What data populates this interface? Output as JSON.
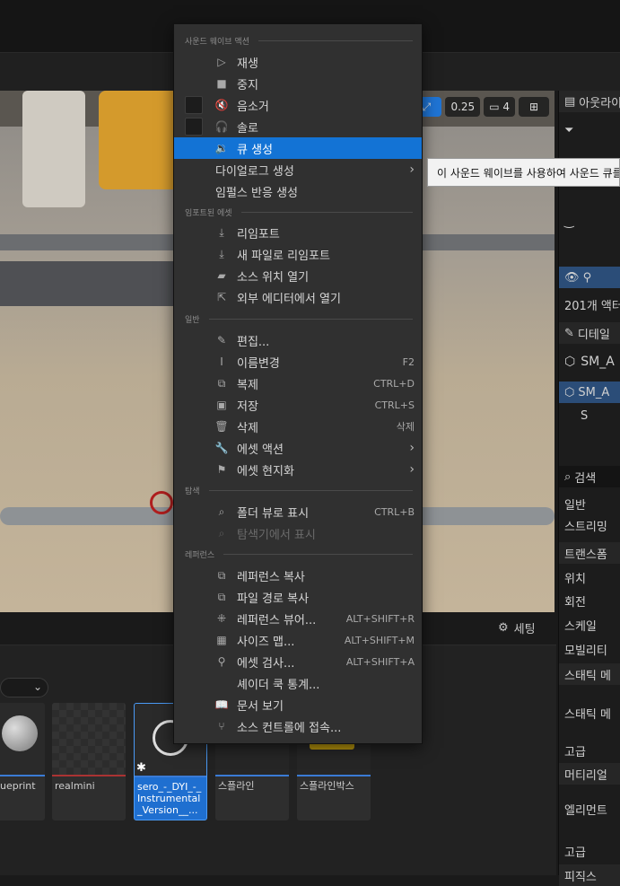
{
  "viewport": {
    "toolbar": {
      "speed": "0.25",
      "camera_speed": "4"
    }
  },
  "right_panel": {
    "outliner_title": "아웃라이",
    "actor_count": "201개 액터",
    "details_title": "디테일",
    "asset_name_1": "SM_A",
    "asset_name_2": "SM_A",
    "asset_sub": "S",
    "search_placeholder": "검색",
    "filter_general": "일반",
    "filter_streaming": "스트리밍",
    "section_transform": "트랜스폼",
    "transform_location": "위치",
    "transform_rotation": "회전",
    "transform_scale": "스케일",
    "mobility": "모빌리티",
    "section_static": "스태틱 메",
    "static_label": "스태틱 메",
    "advanced_1": "고급",
    "section_material": "머티리얼",
    "element_label": "엘리먼트",
    "advanced_2": "고급",
    "section_physics": "피직스"
  },
  "content_browser": {
    "settings_label": "세팅",
    "tiles": [
      {
        "label": "ueprint"
      },
      {
        "label": "realmini"
      },
      {
        "label": "sero_-_DYI_-_Instrumental_Version__..."
      },
      {
        "label": "스플라인"
      },
      {
        "label": "스플라인박스"
      }
    ]
  },
  "context_menu": {
    "sections": {
      "sound_wave_actions": "사운드 웨이브 액션",
      "imported_asset": "임포트된 에셋",
      "general": "일반",
      "explore": "탐색",
      "references": "레퍼런스"
    },
    "items": {
      "play": "재생",
      "stop": "중지",
      "mute": "음소거",
      "solo": "솔로",
      "create_cue": "큐 생성",
      "create_dialogue": "다이얼로그 생성",
      "create_impulse_response": "임펄스 반응 생성",
      "reimport": "리임포트",
      "reimport_new_file": "새 파일로 리임포트",
      "open_source_location": "소스 위치 열기",
      "open_external_editor": "외부 에디터에서 열기",
      "edit": "편집...",
      "rename": "이름변경",
      "duplicate": "복제",
      "save": "저장",
      "delete": "삭제",
      "asset_actions": "에셋 액션",
      "asset_localization": "에셋 현지화",
      "show_in_folder_view": "폴더 뷰로 표시",
      "show_in_explorer": "탐색기에서 표시",
      "copy_reference": "레퍼런스 복사",
      "copy_file_path": "파일 경로 복사",
      "reference_viewer": "레퍼런스 뷰어...",
      "size_map": "사이즈 맵...",
      "audit_asset": "에셋 검사...",
      "shader_cook_stats": "셰이더 쿡 통계...",
      "view_docs": "문서 보기",
      "connect_source_control": "소스 컨트롤에 접속..."
    },
    "shortcuts": {
      "rename": "F2",
      "duplicate": "CTRL+D",
      "save": "CTRL+S",
      "delete": "삭제",
      "show_in_folder_view": "CTRL+B",
      "reference_viewer": "ALT+SHIFT+R",
      "size_map": "ALT+SHIFT+M",
      "audit_asset": "ALT+SHIFT+A"
    }
  },
  "tooltip": {
    "text": "이 사운드 웨이브를 사용하여 사운드 큐를"
  }
}
